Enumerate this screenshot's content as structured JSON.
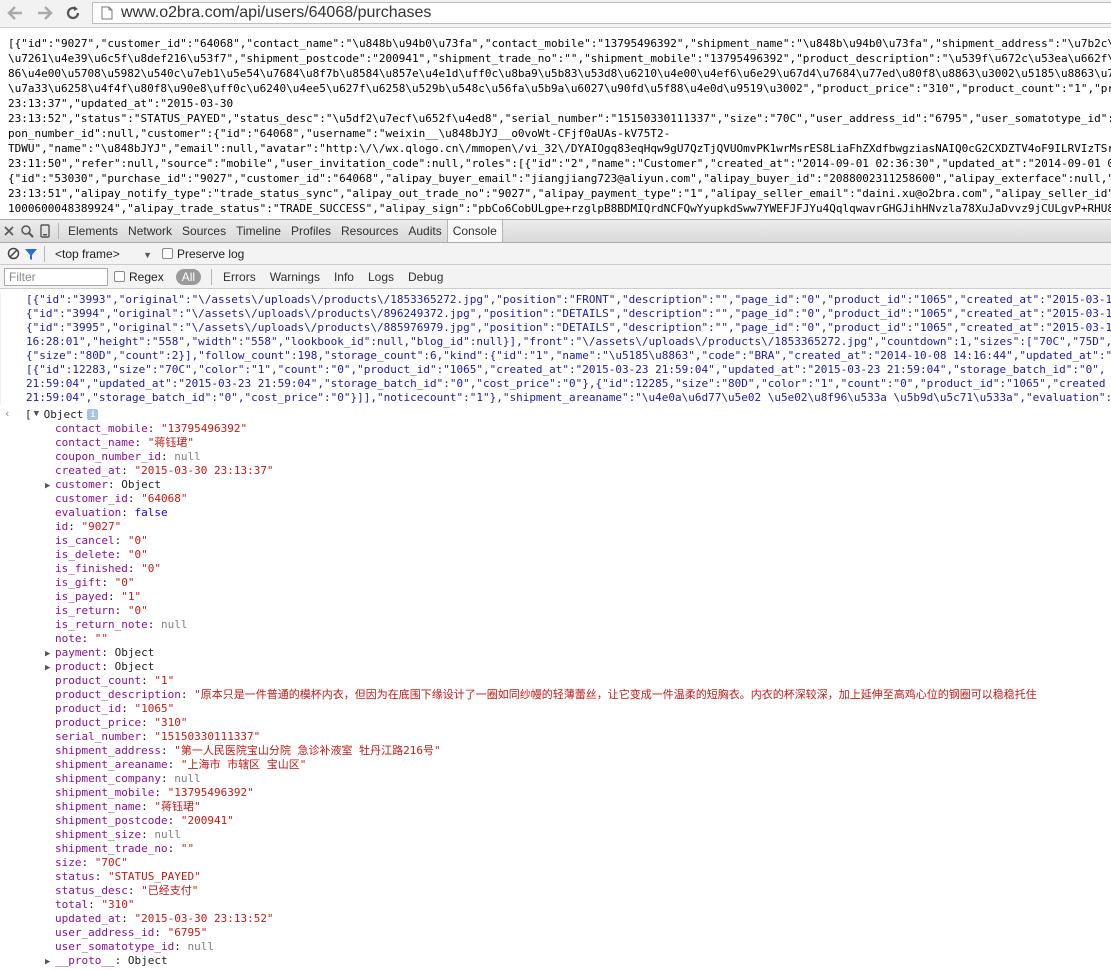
{
  "browser": {
    "url": "www.o2bra.com/api/users/64068/purchases"
  },
  "raw_json_lines": [
    "[{\"id\":\"9027\",\"customer_id\":\"64068\",\"contact_name\":\"\\u848b\\u94b0\\u73fa\",\"contact_mobile\":\"13795496392\",\"shipment_name\":\"\\u848b\\u94b0\\u73fa\",\"shipment_address\":\"\\u7b2c\\u4e00",
    "\\u7261\\u4e39\\u6c5f\\u8def216\\u53f7\",\"shipment_postcode\":\"200941\",\"shipment_trade_no\":\"\",\"shipment_mobile\":\"13795496392\",\"product_description\":\"\\u539f\\u672c\\u53ea\\u662f\\u4e00",
    "86\\u4e00\\u5708\\u5982\\u540c\\u7eb1\\u5e54\\u7684\\u8f7b\\u8584\\u857e\\u4e1d\\uff0c\\u8ba9\\u5b83\\u53d8\\u6210\\u4e00\\u4ef6\\u6e29\\u67d4\\u7684\\u77ed\\u80f8\\u8863\\u3002\\u5185\\u8863\\u7684\\u",
    "\\u7a33\\u6258\\u4f4f\\u80f8\\u90e8\\uff0c\\u6240\\u4ee5\\u627f\\u6258\\u529b\\u548c\\u56fa\\u5b9a\\u6027\\u90fd\\u5f88\\u4e0d\\u9519\\u3002\",\"product_price\":\"310\",\"product_count\":\"1\",\"produ",
    "23:13:37\",\"updated_at\":\"2015-03-30",
    "23:13:52\",\"status\":\"STATUS_PAYED\",\"status_desc\":\"\\u5df2\\u7ecf\\u652f\\u4ed8\",\"serial_number\":\"15150330111337\",\"size\":\"70C\",\"user_address_id\":\"6795\",\"user_somatotype_id\":null",
    "pon_number_id\":null,\"customer\":{\"id\":\"64068\",\"username\":\"weixin__\\u848bJYJ__o0voWt-CFjf0aUAs-kV75T2-",
    "TDWU\",\"name\":\"\\u848bJYJ\",\"email\":null,\"avatar\":\"http:\\/\\/wx.qlogo.cn\\/mmopen\\/vi_32\\/DYAIOgq83eqHqw9gU7QzTjQVUOmvPK1wrMsrES8LiaFhZXdfbwgziasNAIQ0cG2CXDZTV4oF9ILRVIzTSrxia",
    "23:11:50\",\"refer\":null,\"source\":\"mobile\",\"user_invitation_code\":null,\"roles\":[{\"id\":\"2\",\"name\":\"Customer\",\"created_at\":\"2014-09-01 02:36:30\",\"updated_at\":\"2014-09-01 02:3",
    "{\"id\":\"53030\",\"purchase_id\":\"9027\",\"customer_id\":\"64068\",\"alipay_buyer_email\":\"jiangjiang723@aliyun.com\",\"alipay_buyer_id\":\"2088002311258600\",\"alipay_exterface\":null,\"ali",
    "23:13:51\",\"alipay_notify_type\":\"trade_status_sync\",\"alipay_out_trade_no\":\"9027\",\"alipay_payment_type\":\"1\",\"alipay_seller_email\":\"daini.xu@o2bra.com\",\"alipay_seller_id\":\"2",
    "1000600048389924\",\"alipay_trade_status\":\"TRADE_SUCCESS\",\"alipay_sign\":\"pbCo6CobULgpe+rzglpB8BDMIQrdNCFQwYyupkdSww7YWEFJFJYu4QqlqwavrGHGJihHNvzla78XuJaDvvz9jCULgvP+RHU8fZo"
  ],
  "devtools": {
    "tabs": [
      "Elements",
      "Network",
      "Sources",
      "Timeline",
      "Profiles",
      "Resources",
      "Audits",
      "Console"
    ],
    "selected_tab": "Console",
    "frame": "<top frame>",
    "preserve_log": "Preserve log",
    "filter_placeholder": "Filter",
    "regex": "Regex",
    "all": "All",
    "levels": [
      "Errors",
      "Warnings",
      "Info",
      "Logs",
      "Debug"
    ]
  },
  "console_blue_lines": [
    "[{\"id\":\"3993\",\"original\":\"\\/assets\\/uploads\\/products\\/1853365272.jpg\",\"position\":\"FRONT\",\"description\":\"\",\"page_id\":\"0\",\"product_id\":\"1065\",\"created_at\":\"2015-03-11",
    "{\"id\":\"3994\",\"original\":\"\\/assets\\/uploads\\/products\\/896249372.jpg\",\"position\":\"DETAILS\",\"description\":\"\",\"page_id\":\"0\",\"product_id\":\"1065\",\"created_at\":\"2015-03-11",
    "{\"id\":\"3995\",\"original\":\"\\/assets\\/uploads\\/products\\/885976979.jpg\",\"position\":\"DETAILS\",\"description\":\"\",\"page_id\":\"0\",\"product_id\":\"1065\",\"created_at\":\"2015-03-11",
    "16:28:01\",\"height\":\"558\",\"width\":\"558\",\"lookbook_id\":null,\"blog_id\":null}],\"front\":\"\\/assets\\/uploads\\/products\\/1853365272.jpg\",\"countdown\":1,\"sizes\":[\"70C\",\"75D\",\"",
    "{\"size\":\"80D\",\"count\":2}],\"follow_count\":198,\"storage_count\":6,\"kind\":{\"id\":\"1\",\"name\":\"\\u5185\\u8863\",\"code\":\"BRA\",\"created_at\":\"2014-10-08 14:16:44\",\"updated_at\":\"2",
    "[{\"id\":12283,\"size\":\"70C\",\"color\":\"1\",\"count\":\"0\",\"product_id\":\"1065\",\"created_at\":\"2015-03-23 21:59:04\",\"updated_at\":\"2015-03-23 21:59:04\",\"storage_batch_id\":\"0\",",
    "21:59:04\",\"updated_at\":\"2015-03-23 21:59:04\",\"storage_batch_id\":\"0\",\"cost_price\":\"0\"},{\"id\":12285,\"size\":\"80D\",\"color\":\"1\",\"count\":\"0\",\"product_id\":\"1065\",\"created",
    "21:59:04\",\"storage_batch_id\":\"0\",\"cost_price\":\"0\"}]],\"noticecount\":\"1\"},\"shipment_areaname\":\"\\u4e0a\\u6d77\\u5e02 \\u5e02\\u8f96\\u533a \\u5b9d\\u5c71\\u533a\",\"evaluation\":fal"
  ],
  "object_header": {
    "bracket": "[",
    "label": "Object"
  },
  "object_props": [
    {
      "key": "contact_mobile",
      "value": "\"13795496392\"",
      "type": "string"
    },
    {
      "key": "contact_name",
      "value": "\"蒋钰珺\"",
      "type": "string"
    },
    {
      "key": "coupon_number_id",
      "value": "null",
      "type": "null"
    },
    {
      "key": "created_at",
      "value": "\"2015-03-30 23:13:37\"",
      "type": "string"
    },
    {
      "key": "customer",
      "value": "Object",
      "type": "object",
      "expandable": true
    },
    {
      "key": "customer_id",
      "value": "\"64068\"",
      "type": "string"
    },
    {
      "key": "evaluation",
      "value": "false",
      "type": "bool"
    },
    {
      "key": "id",
      "value": "\"9027\"",
      "type": "string"
    },
    {
      "key": "is_cancel",
      "value": "\"0\"",
      "type": "string"
    },
    {
      "key": "is_delete",
      "value": "\"0\"",
      "type": "string"
    },
    {
      "key": "is_finished",
      "value": "\"0\"",
      "type": "string"
    },
    {
      "key": "is_gift",
      "value": "\"0\"",
      "type": "string"
    },
    {
      "key": "is_payed",
      "value": "\"1\"",
      "type": "string"
    },
    {
      "key": "is_return",
      "value": "\"0\"",
      "type": "string"
    },
    {
      "key": "is_return_note",
      "value": "null",
      "type": "null"
    },
    {
      "key": "note",
      "value": "\"\"",
      "type": "string"
    },
    {
      "key": "payment",
      "value": "Object",
      "type": "object",
      "expandable": true
    },
    {
      "key": "product",
      "value": "Object",
      "type": "object",
      "expandable": true
    },
    {
      "key": "product_count",
      "value": "\"1\"",
      "type": "string"
    },
    {
      "key": "product_description",
      "value": "\"原本只是一件普通的模杯内衣，但因为在底围下缘设计了一圈如同纱幔的轻薄蕾丝，让它变成一件温柔的短胸衣。内衣的杯深较深，加上延伸至高鸡心位的钢圈可以稳稳托住",
      "type": "string"
    },
    {
      "key": "product_id",
      "value": "\"1065\"",
      "type": "string"
    },
    {
      "key": "product_price",
      "value": "\"310\"",
      "type": "string"
    },
    {
      "key": "serial_number",
      "value": "\"15150330111337\"",
      "type": "string"
    },
    {
      "key": "shipment_address",
      "value": "\"第一人民医院宝山分院 急诊补液室 牡丹江路216号\"",
      "type": "string"
    },
    {
      "key": "shipment_areaname",
      "value": "\"上海市 市辖区 宝山区\"",
      "type": "string"
    },
    {
      "key": "shipment_company",
      "value": "null",
      "type": "null"
    },
    {
      "key": "shipment_mobile",
      "value": "\"13795496392\"",
      "type": "string"
    },
    {
      "key": "shipment_name",
      "value": "\"蒋钰珺\"",
      "type": "string"
    },
    {
      "key": "shipment_postcode",
      "value": "\"200941\"",
      "type": "string"
    },
    {
      "key": "shipment_size",
      "value": "null",
      "type": "null"
    },
    {
      "key": "shipment_trade_no",
      "value": "\"\"",
      "type": "string"
    },
    {
      "key": "size",
      "value": "\"70C\"",
      "type": "string"
    },
    {
      "key": "status",
      "value": "\"STATUS_PAYED\"",
      "type": "string"
    },
    {
      "key": "status_desc",
      "value": "\"已经支付\"",
      "type": "string"
    },
    {
      "key": "total",
      "value": "\"310\"",
      "type": "string"
    },
    {
      "key": "updated_at",
      "value": "\"2015-03-30 23:13:52\"",
      "type": "string"
    },
    {
      "key": "user_address_id",
      "value": "\"6795\"",
      "type": "string"
    },
    {
      "key": "user_somatotype_id",
      "value": "null",
      "type": "null"
    },
    {
      "key": "__proto__",
      "value": "Object",
      "type": "object",
      "expandable": true
    }
  ],
  "colors": {
    "key": "#881391",
    "string": "#c41a16",
    "number": "#1c00cf",
    "null": "#808080",
    "log_text": "#1a1aa6"
  }
}
